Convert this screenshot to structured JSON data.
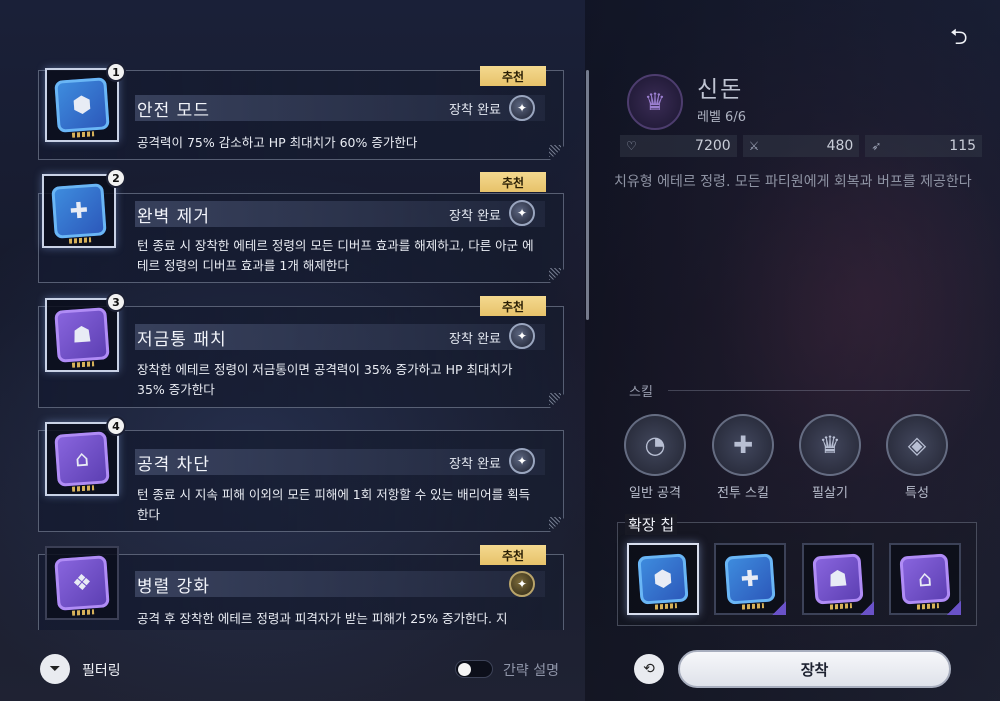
{
  "list": {
    "items": [
      {
        "number": "1",
        "recommended_label": "추천",
        "name": "안전 모드",
        "status": "장착 완료",
        "description": "공격력이 75% 감소하고 HP 최대치가 60% 증가한다",
        "chip_color": "blue",
        "icon": "shield-icon"
      },
      {
        "number": "2",
        "recommended_label": "추천",
        "name": "완벽 제거",
        "status": "장착 완료",
        "description": "턴 종료 시 장착한 에테르 정령의 모든 디버프 효과를 해제하고, 다른 아군 에테르 정령의 디버프 효과를 1개 해제한다",
        "chip_color": "blue",
        "icon": "heal-cross-icon"
      },
      {
        "number": "3",
        "recommended_label": "추천",
        "name": "저금통 패치",
        "status": "장착 완료",
        "description": "장착한 에테르 정령이 저금통이면 공격력이 35% 증가하고 HP 최대치가 35% 증가한다",
        "chip_color": "purple",
        "icon": "piggy-bank-icon"
      },
      {
        "number": "4",
        "recommended_label": "",
        "name": "공격 차단",
        "status": "장착 완료",
        "description": "턴 종료 시 지속 피해 이외의 모든 피해에 1회 저항할 수 있는 배리어를 획득한다",
        "chip_color": "purple",
        "icon": "barrier-icon"
      },
      {
        "number": "",
        "recommended_label": "추천",
        "name": "병렬 강화",
        "status": "",
        "description": "공격 후 장착한 에테르 정령과 피격자가 받는 피해가 25% 증가한다. 지",
        "chip_color": "purple",
        "icon": "sword-boost-icon"
      }
    ]
  },
  "bottom_left": {
    "filter_label": "필터링",
    "toggle_label": "간략 설명",
    "toggle_on": false
  },
  "character": {
    "name": "신돈",
    "level": "레벨 6/6",
    "stats": [
      {
        "icon": "heart-icon",
        "value": "7200"
      },
      {
        "icon": "sword-icon",
        "value": "480"
      },
      {
        "icon": "speed-icon",
        "value": "115"
      }
    ],
    "description": "치유형 에테르 정령. 모든 파티원에게 회복과 버프를 제공한다"
  },
  "skills": {
    "header": "스킬",
    "items": [
      {
        "label": "일반 공격",
        "icon": "gauge-icon"
      },
      {
        "label": "전투 스킬",
        "icon": "heal-plus-icon"
      },
      {
        "label": "필살기",
        "icon": "crest-icon"
      },
      {
        "label": "특성",
        "icon": "layers-icon"
      }
    ]
  },
  "extension": {
    "title": "확장 칩",
    "slots": [
      {
        "chip_color": "blue",
        "icon": "shield-icon",
        "active": true
      },
      {
        "chip_color": "blue",
        "icon": "heal-cross-icon",
        "active": false
      },
      {
        "chip_color": "purple",
        "icon": "piggy-bank-icon",
        "active": false
      },
      {
        "chip_color": "purple",
        "icon": "barrier-icon",
        "active": false
      }
    ]
  },
  "actions": {
    "equip_label": "장착"
  }
}
